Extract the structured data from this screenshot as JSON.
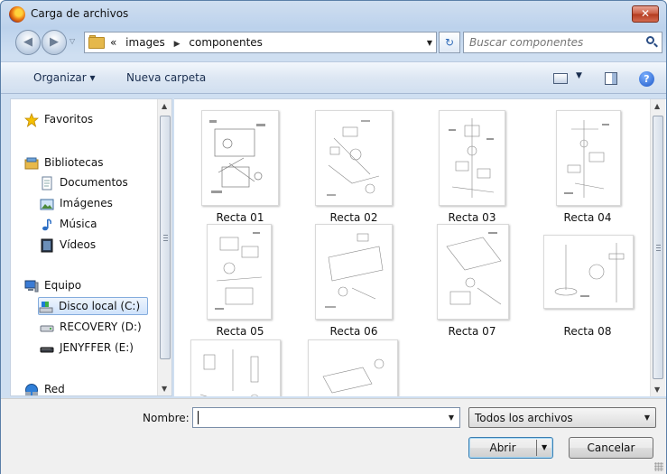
{
  "window": {
    "title": "Carga de archivos",
    "close_glyph": "✕"
  },
  "address": {
    "crumbs": [
      "«",
      "images",
      "componentes"
    ],
    "search_placeholder": "Buscar componentes"
  },
  "toolbar": {
    "organize_label": "Organizar ▾",
    "new_folder_label": "Nueva carpeta",
    "help_glyph": "?"
  },
  "nav": {
    "favorites": "Favoritos",
    "libraries": "Bibliotecas",
    "library_items": [
      "Documentos",
      "Imágenes",
      "Música",
      "Vídeos"
    ],
    "computer": "Equipo",
    "drives": [
      "Disco local (C:)",
      "RECOVERY (D:)",
      "JENYFFER (E:)"
    ],
    "selected_drive": "Disco local (C:)",
    "network": "Red"
  },
  "files": [
    {
      "name": "Recta 01"
    },
    {
      "name": "Recta 02"
    },
    {
      "name": "Recta 03"
    },
    {
      "name": "Recta 04"
    },
    {
      "name": "Recta 05"
    },
    {
      "name": "Recta 06"
    },
    {
      "name": "Recta 07"
    },
    {
      "name": "Recta 08"
    },
    {
      "name": ""
    },
    {
      "name": ""
    }
  ],
  "bottom": {
    "name_label": "Nombre:",
    "name_value": "",
    "filter_value": "Todos los archivos",
    "open_label": "Abrir",
    "cancel_label": "Cancelar"
  },
  "colors": {
    "accent": "#2e6ab8",
    "titlebar": "#bcd2ec",
    "selection": "#cfe3fb"
  }
}
